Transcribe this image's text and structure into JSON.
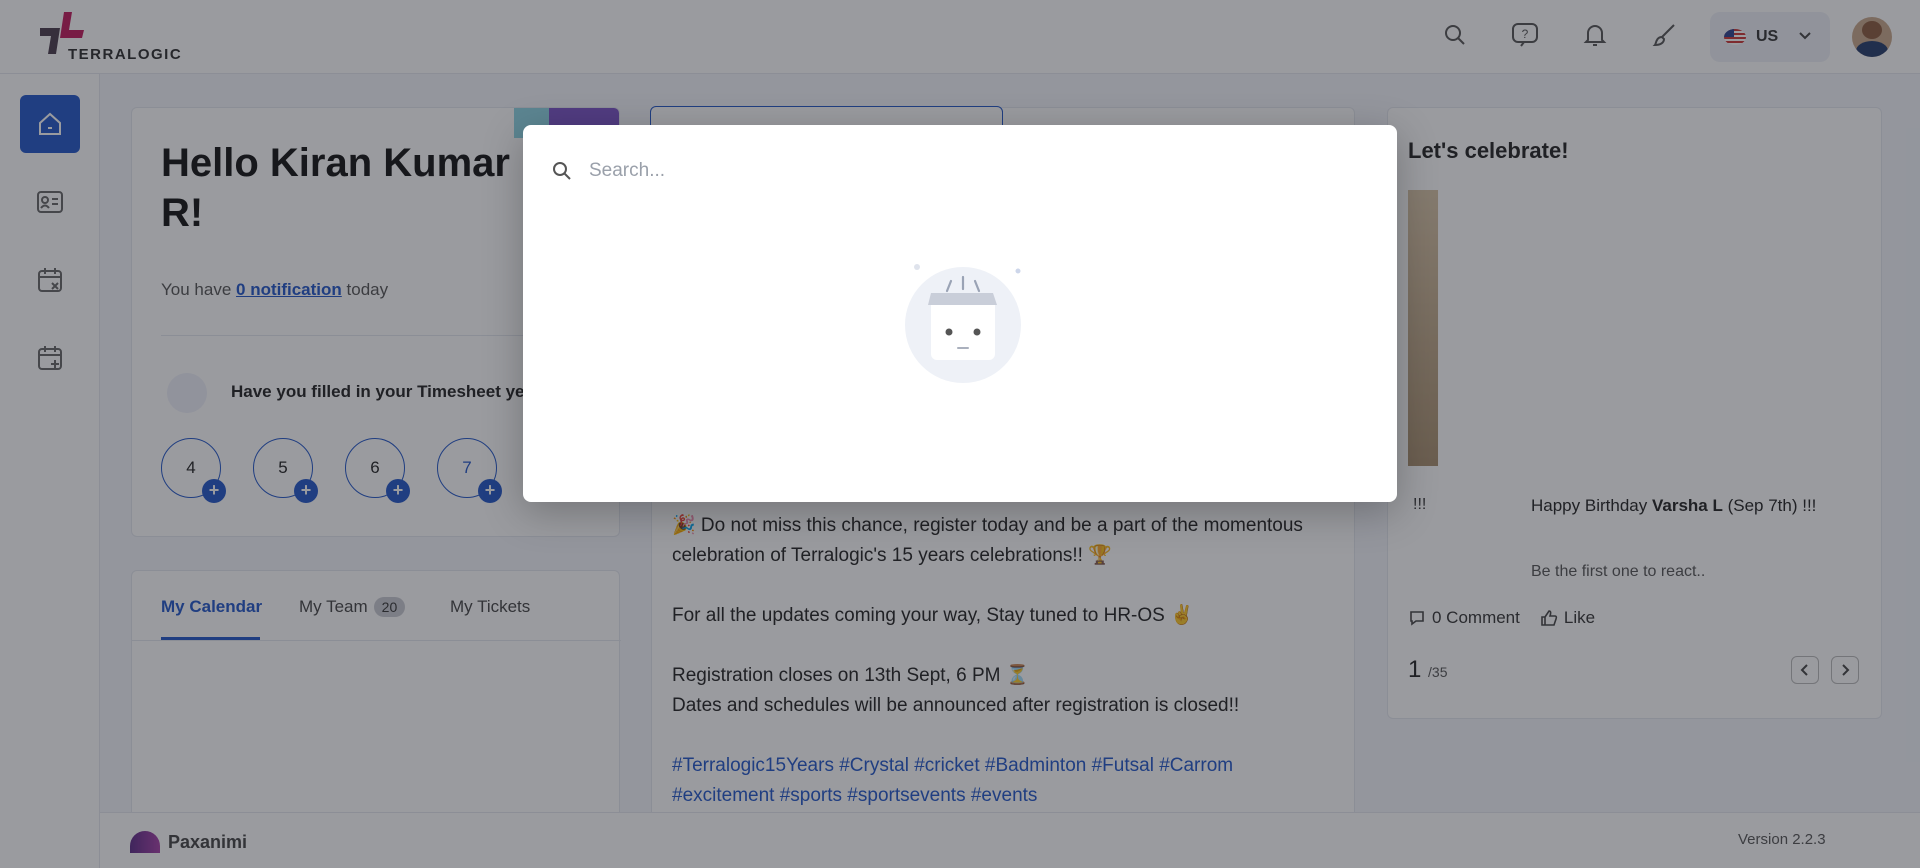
{
  "header": {
    "logo_text": "TERRALOGIC",
    "icons": [
      "search-icon",
      "help-icon",
      "bell-icon",
      "brush-icon"
    ],
    "language": "US",
    "brand_color": "#2156c9"
  },
  "sidebar": {
    "items": [
      {
        "name": "home",
        "icon": "home-icon",
        "active": true
      },
      {
        "name": "profile",
        "icon": "id-card-icon",
        "active": false
      },
      {
        "name": "leave",
        "icon": "calendar-x-icon",
        "active": false
      },
      {
        "name": "apply",
        "icon": "calendar-plus-icon",
        "active": false
      }
    ]
  },
  "hello_card": {
    "greeting": "Hello Kiran Kumar B R!",
    "notif_prefix": "You have",
    "notif_link": "0 notification",
    "notif_suffix": "today",
    "timesheet_question": "Have you filled in your Timesheet yet?",
    "days": [
      "4",
      "5",
      "6",
      "7"
    ]
  },
  "tabs": {
    "items": [
      "My Calendar",
      "My Team",
      "My Tickets"
    ],
    "team_count": "20"
  },
  "feed": {
    "para1": "🎉 Do not miss this chance, register today and be a part of the momentous celebration of Terralogic's 15 years celebrations!! 🏆",
    "para2": "For all the updates coming your way, Stay tuned to HR-OS ✌",
    "para3a": "Registration closes on 13th Sept, 6 PM ⏳",
    "para3b": "Dates and schedules will be announced after registration is closed!!",
    "tags": "#Terralogic15Years #Crystal #cricket #Badminton #Futsal #Carrom #excitement #sports #sportsevents #events"
  },
  "celebrate": {
    "title": "Let's celebrate!",
    "left_fragment": "!!!",
    "bday_prefix": "Happy Birthday",
    "bday_name": "Varsha L",
    "bday_suffix": "(Sep 7th) !!!",
    "react_text": "Be the first one to react..",
    "comment_label": "0 Comment",
    "like_label": "Like",
    "page_current": "1",
    "page_total": "/35"
  },
  "footer": {
    "brand": "Paxanimi",
    "version": "Version 2.2.3"
  },
  "search_modal": {
    "placeholder": "Search...",
    "value": ""
  }
}
